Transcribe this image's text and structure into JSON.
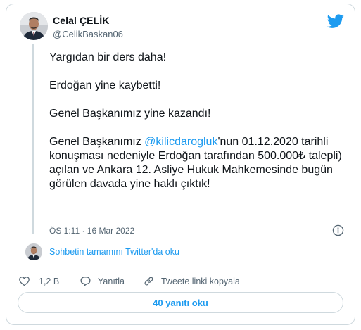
{
  "author": {
    "name": "Celal ÇELİK",
    "handle": "@CelikBaskan06",
    "avatar": "profile-photo"
  },
  "brand": {
    "icon": "twitter-bird-icon",
    "color": "#1d9bf0"
  },
  "tweet": {
    "line1": "Yargıdan bir ders daha!",
    "line2": "Erdoğan yine kaybetti!",
    "line3": "Genel Başkanımız yine kazandı!",
    "line4_pre": "Genel Başkanımız ",
    "line4_mention": "@kilicdarogluk",
    "line4_post": "'nun 01.12.2020 tarihli konuşması nedeniyle Erdoğan tarafından 500.000₺ talepli) açılan ve Ankara 12. Asliye Hukuk Mahkemesinde bugün görülen davada yine haklı çıktık!"
  },
  "timestamp": "ÖS 1:11 · 16 Mar 2022",
  "read_thread": "Sohbetin tamamını Twitter'da oku",
  "actions": {
    "like_count": "1,2 B",
    "reply_label": "Yanıtla",
    "copy_label": "Tweete linki kopyala"
  },
  "replies_button": "40 yanıtı oku",
  "colors": {
    "link": "#1d9bf0",
    "text": "#0f1419",
    "secondary": "#536471",
    "border": "#cfd9de"
  }
}
